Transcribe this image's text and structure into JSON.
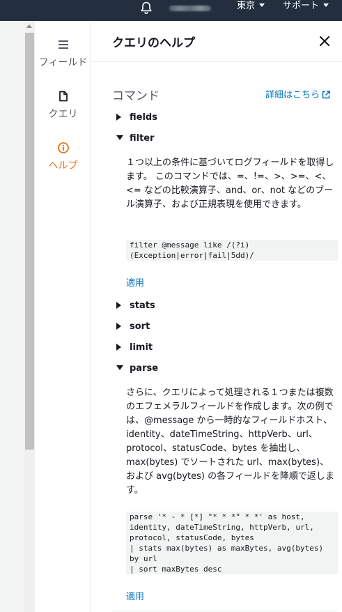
{
  "topnav": {
    "region_label": "東京",
    "support_label": "サポート"
  },
  "sidebar": {
    "tabs": [
      {
        "label": "フィールド",
        "icon": "hamburger-icon"
      },
      {
        "label": "クエリ",
        "icon": "file-icon"
      },
      {
        "label": "ヘルプ",
        "icon": "info-circle-icon",
        "active": true
      }
    ]
  },
  "help": {
    "title": "クエリのヘルプ",
    "section_title": "コマンド",
    "learn_more_label": "詳細はこちら",
    "commands": [
      {
        "name": "fields",
        "expanded": false
      },
      {
        "name": "filter",
        "expanded": true,
        "description": "１つ以上の条件に基づいてログフィールドを取得します。 このコマンドでは、=、!=、>、>=、<、<= などの比較演算子、and、or、not などのブール演算子、および正規表現を使用できます。",
        "code": "filter @message like /(?i)\n(Exception|error|fail|5dd)/",
        "apply_label": "適用"
      },
      {
        "name": "stats",
        "expanded": false
      },
      {
        "name": "sort",
        "expanded": false
      },
      {
        "name": "limit",
        "expanded": false
      },
      {
        "name": "parse",
        "expanded": true,
        "description": "さらに、クエリによって処理される１つまたは複数のエフェメラルフィールドを作成します。次の例では、@message から一時的なフィールドホスト、identity、dateTimeString、httpVerb、url、protocol、statusCode、bytes を抽出し、max(bytes) でソートされた url、max(bytes)、および avg(bytes) の各フィールドを降順で返します。",
        "code": "parse '* - * [*] \"* * *\" * *' as host,\nidentity, dateTimeString, httpVerb, url,\nprotocol, statusCode, bytes\n| stats max(bytes) as maxBytes, avg(bytes)\nby url\n| sort maxBytes desc",
        "apply_label": "適用"
      }
    ]
  },
  "colors": {
    "nav_bg": "#232f3e",
    "active_tab": "#ec7211",
    "link": "#0073bb"
  }
}
